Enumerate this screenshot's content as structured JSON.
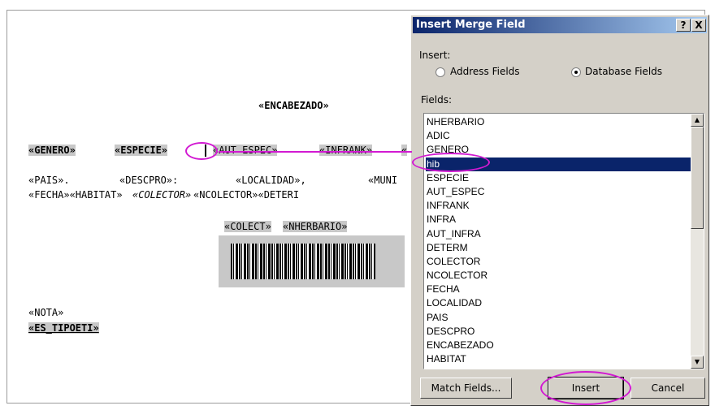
{
  "document": {
    "header_field": "«ENCABEZADO»",
    "line1": [
      "«GENERO»",
      "«ESPECIE»",
      "«AUT ESPEC»",
      "«INFRANK»",
      "«"
    ],
    "line2": [
      "«PAIS».",
      "«DESCPRO»:",
      "«LOCALIDAD»,",
      "«MUNI"
    ],
    "line3": [
      "«FECHA»«HABITAT»",
      "«COLECTOR»",
      "«NCOLECTOR»«DETERI"
    ],
    "barcode_labels": [
      "«COLECT»",
      "«NHERBARIO»"
    ],
    "nota": "«NOTA»",
    "es_tipoeti": "«ES_TIPOETI»"
  },
  "dialog": {
    "title": "Insert Merge Field",
    "help_btn": "?",
    "close_btn": "X",
    "insert_label": "Insert:",
    "radio_address": "Address Fields",
    "radio_database": "Database Fields",
    "radio_selected": "database",
    "fields_label": "Fields:",
    "fields": [
      "NHERBARIO",
      "ADIC",
      "GENERO",
      "hib",
      "ESPECIE",
      "AUT_ESPEC",
      "INFRANK",
      "INFRA",
      "AUT_INFRA",
      "DETERM",
      "COLECTOR",
      "NCOLECTOR",
      "FECHA",
      "LOCALIDAD",
      "PAIS",
      "DESCPRO",
      "ENCABEZADO",
      "HABITAT"
    ],
    "selected_field": "hib",
    "buttons": {
      "match": "Match Fields...",
      "insert": "Insert",
      "cancel": "Cancel"
    }
  },
  "annotation_color": "#d21ad2"
}
